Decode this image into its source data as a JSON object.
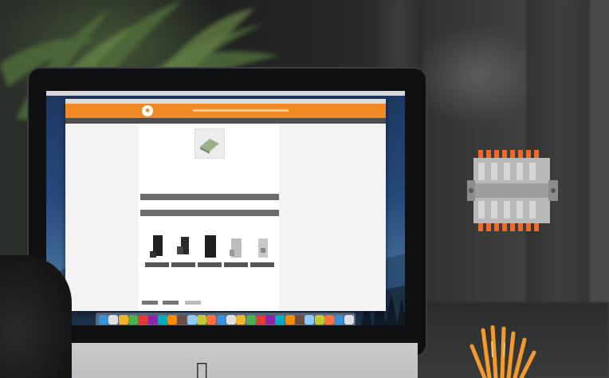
{
  "scene": {
    "description_tag": "",
    "colors": {
      "site_accent": "#f08a24",
      "site_dark_bar": "#4e4e4e",
      "connector_orange": "#ef6a2a",
      "connector_gray": "#b8b8b8"
    }
  },
  "device": {
    "brand_logo_icon": "apple-logo-icon"
  },
  "webpage": {
    "logo_icon": "brand-logo-icon",
    "variant_count": 5
  },
  "dock": {
    "icon_count": 26
  }
}
